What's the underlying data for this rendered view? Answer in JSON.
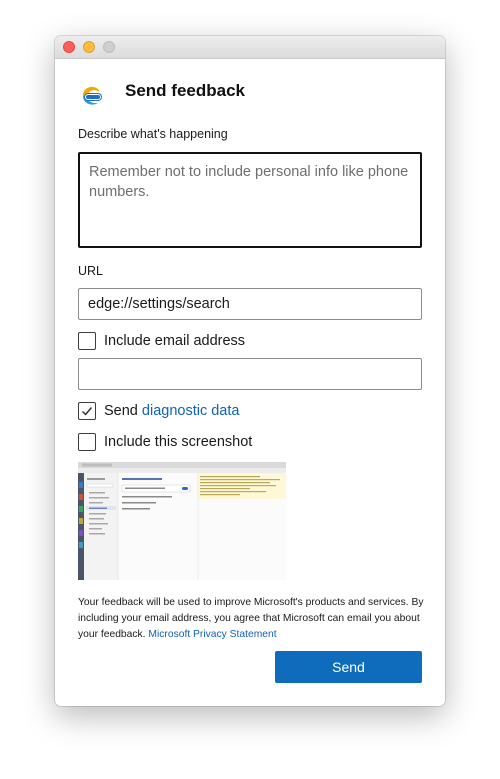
{
  "dialog": {
    "title": "Send feedback",
    "logo_icon": "edge-canary-icon"
  },
  "describe": {
    "label": "Describe what's happening",
    "placeholder": "Remember not to include personal info like phone numbers.",
    "value": ""
  },
  "url": {
    "label": "URL",
    "value": "edge://settings/search"
  },
  "email": {
    "checkbox_label": "Include email address",
    "checked": false,
    "value": "",
    "placeholder": ""
  },
  "diagnostic": {
    "prefix": "Send",
    "link_text": "diagnostic data",
    "checked": true
  },
  "screenshot": {
    "checkbox_label": "Include this screenshot",
    "checked": false
  },
  "disclaimer": {
    "text": "Your feedback will be used to improve Microsoft's products and services. By including your email address, you agree that Microsoft can email you about your feedback.",
    "link_text": "Microsoft Privacy Statement"
  },
  "actions": {
    "send_label": "Send"
  },
  "colors": {
    "accent": "#0f6cbd",
    "link": "#0f62b9"
  }
}
